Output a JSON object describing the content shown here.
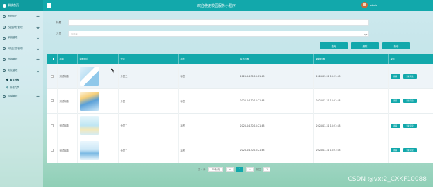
{
  "header": {
    "logo_text": "系统首页",
    "app_title": "欢迎使用校园服务小程序",
    "username": "admin"
  },
  "sidebar": {
    "items": [
      {
        "label": "系统用户"
      },
      {
        "label": "校园学校管理"
      },
      {
        "label": "系统管理"
      },
      {
        "label": "网站公告管理"
      },
      {
        "label": "资源管理"
      },
      {
        "label": "文化管理"
      },
      {
        "label": "领域管理"
      }
    ],
    "subitems": [
      {
        "label": "留言列表",
        "active": true
      },
      {
        "label": "新增文章",
        "active": false
      }
    ]
  },
  "search": {
    "title_label": "标题",
    "title_placeholder": "",
    "category_label": "分类",
    "category_placeholder": "请选择"
  },
  "actions": {
    "query": "查询",
    "delete": "删除",
    "add": "新增"
  },
  "table": {
    "columns": [
      "",
      "标题",
      "封面图片",
      "分类",
      "标签",
      "发布时间",
      "更新时间",
      "操作"
    ],
    "rows": [
      {
        "title": "测试标题",
        "category": "分类二",
        "tag": "标签",
        "publish": "2024-04-30 16:21:48",
        "update": "2024-03-31 16:21:48"
      },
      {
        "title": "测试标题",
        "category": "分类一",
        "tag": "标签",
        "publish": "2024-04-30 16:21:48",
        "update": "2024-03-31 16:21:48"
      },
      {
        "title": "测试标题",
        "category": "分类二",
        "tag": "标签",
        "publish": "2024-04-30 16:21:48",
        "update": "2024-03-31 16:21:48"
      },
      {
        "title": "测试标题",
        "category": "分类二",
        "tag": "标签",
        "publish": "2024-04-30 16:21:48",
        "update": "2024-03-31 16:21:48"
      }
    ],
    "edit_label": "详情",
    "view_label": "查看评论"
  },
  "pager": {
    "total": "共 4 条",
    "page_size": "10条/页",
    "prev": "<",
    "current": "1",
    "next": ">",
    "goto_label": "前往",
    "goto_value": "1"
  },
  "watermark": "CSDN @vx:2_CXKF10088",
  "colors": {
    "accent": "#12a8ab"
  }
}
